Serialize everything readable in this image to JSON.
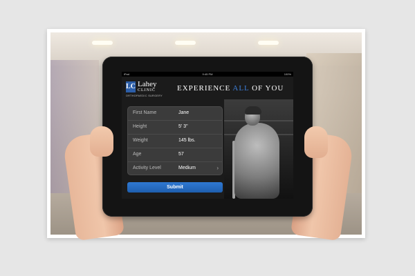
{
  "status_bar": {
    "left": "iPad",
    "time": "9:45 PM",
    "battery": "100%"
  },
  "brand": {
    "logo_mark": "LC",
    "name": "Lahey",
    "sub": "CLINIC",
    "tagline": "ORTHOPAEDIC SURGERY"
  },
  "headline": {
    "part1": "EXPERIENCE ",
    "accent": "ALL",
    "part2": " OF YOU"
  },
  "form": {
    "rows": [
      {
        "label": "First Name",
        "value": "Jane"
      },
      {
        "label": "Height",
        "value": "5' 3\""
      },
      {
        "label": "Weight",
        "value": "145 lbs."
      },
      {
        "label": "Age",
        "value": "57"
      },
      {
        "label": "Activity Level",
        "value": "Medium",
        "chevron": "›"
      }
    ],
    "submit_label": "Submit"
  },
  "colors": {
    "accent": "#3d7ed8",
    "brand_blue": "#2c5ea8",
    "submit": "#1f5faf"
  }
}
